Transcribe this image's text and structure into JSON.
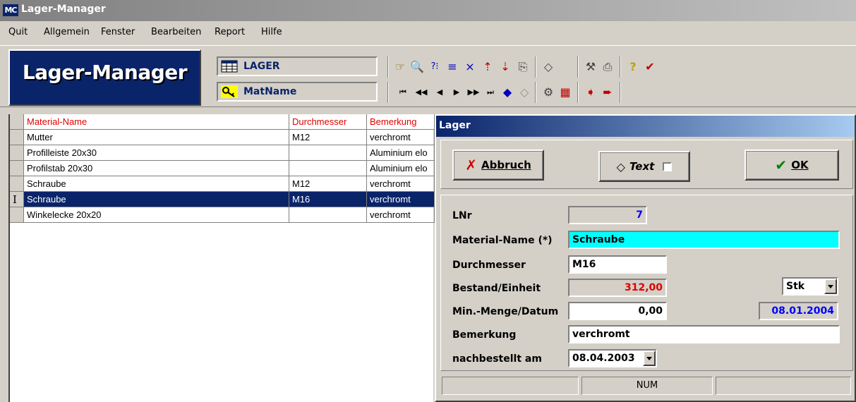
{
  "window": {
    "title": "Lager-Manager",
    "icon_text": "MC"
  },
  "menu": [
    "Quit",
    "Allgemein",
    "Fenster",
    "Bearbeiten",
    "Report",
    "Hilfe"
  ],
  "toolbar": {
    "logo": "Lager-Manager",
    "table_selector": "LAGER",
    "index_selector": "MatName"
  },
  "grid": {
    "columns": [
      "Material-Name",
      "Durchmesser",
      "Bemerkung"
    ],
    "rows": [
      [
        "Mutter",
        "M12",
        "verchromt"
      ],
      [
        "Profilleiste 20x30",
        "",
        "Aluminium elo"
      ],
      [
        "Profilstab 20x30",
        "",
        "Aluminium elo"
      ],
      [
        "Schraube",
        "M12",
        "verchromt"
      ],
      [
        "Schraube",
        "M16",
        "verchromt"
      ],
      [
        "Winkelecke 20x20",
        "",
        "verchromt"
      ]
    ],
    "selected_row": 4,
    "row_marker": "I"
  },
  "dialog": {
    "title": "Lager",
    "buttons": {
      "cancel": "Abbruch",
      "text": "Text",
      "ok": "OK"
    },
    "fields": {
      "lnr_label": "LNr",
      "lnr_value": "7",
      "material_label": "Material-Name (*)",
      "material_value": "Schraube",
      "durchmesser_label": "Durchmesser",
      "durchmesser_value": "M16",
      "bestand_label": "Bestand/Einheit",
      "bestand_value": "312,00",
      "einheit_value": "Stk",
      "minmenge_label": "Min.-Menge/Datum",
      "minmenge_value": "0,00",
      "datum_value": "08.01.2004",
      "bemerkung_label": "Bemerkung",
      "bemerkung_value": "verchromt",
      "nachbestellt_label": "nachbestellt am",
      "nachbestellt_value": "08.04.2003"
    },
    "status": [
      "",
      "NUM",
      ""
    ]
  },
  "colors": {
    "titlebar_active": "#0a246a",
    "header_text": "#e00000",
    "material_bg": "#00ffff",
    "bestand_text": "#e00000",
    "lnr_text": "#0000ff"
  }
}
